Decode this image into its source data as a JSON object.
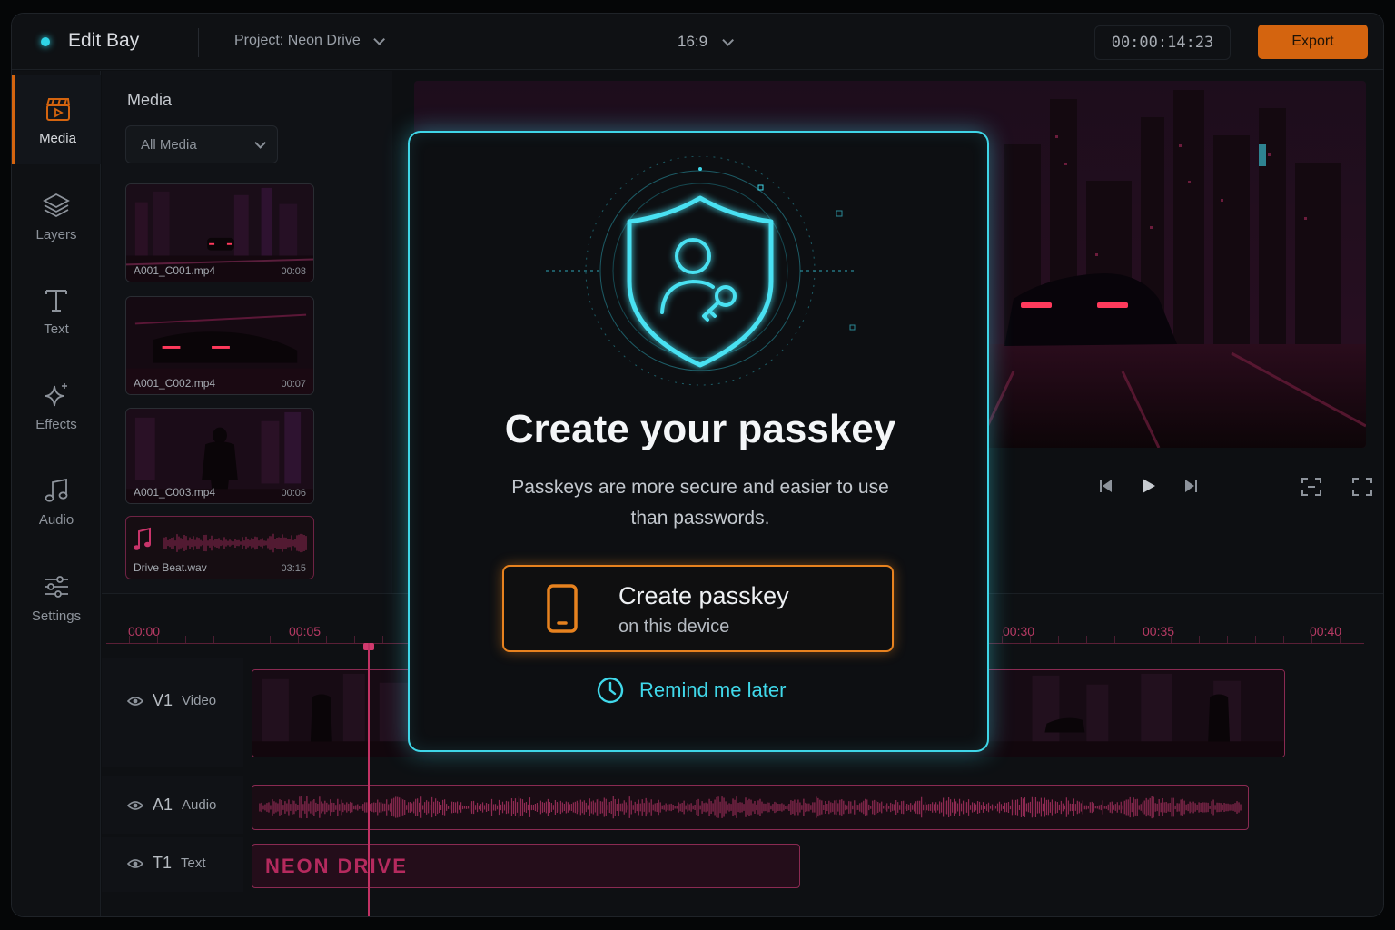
{
  "app": {
    "title": "Edit Bay",
    "accent": "#d4640f",
    "cyan": "#3fd6e8",
    "magenta": "#b52a5e"
  },
  "topbar": {
    "project": "Project: Neon Drive",
    "ratio": "16:9",
    "timecode": "00:00:14:23",
    "export_label": "Export"
  },
  "rail": {
    "items": [
      {
        "label": "Media",
        "icon": "clapperboard-icon"
      },
      {
        "label": "Layers",
        "icon": "layers-icon"
      },
      {
        "label": "Text",
        "icon": "text-icon"
      },
      {
        "label": "Effects",
        "icon": "sparkle-icon"
      },
      {
        "label": "Audio",
        "icon": "music-note-icon"
      },
      {
        "label": "Settings",
        "icon": "sliders-icon"
      }
    ]
  },
  "media": {
    "title": "Media",
    "filter": "All Media",
    "clips": [
      {
        "name": "A001_C001.mp4",
        "duration": "00:08"
      },
      {
        "name": "A001_C002.mp4",
        "duration": "00:07"
      },
      {
        "name": "A001_C003.mp4",
        "duration": "00:06"
      },
      {
        "name": "Drive Beat.wav",
        "duration": "03:15"
      }
    ]
  },
  "timeline": {
    "ruler": [
      "00:00",
      "00:05",
      "00:30",
      "00:35",
      "00:40"
    ],
    "tracks": [
      {
        "id": "V1",
        "kind": "Video"
      },
      {
        "id": "A1",
        "kind": "Audio"
      },
      {
        "id": "T1",
        "kind": "Text"
      }
    ],
    "text_clip": "NEON DRIVE"
  },
  "modal": {
    "title": "Create your passkey",
    "description": "Passkeys are more secure and easier to use than passwords.",
    "primary_line1": "Create passkey",
    "primary_line2": "on this device",
    "secondary": "Remind me later"
  }
}
